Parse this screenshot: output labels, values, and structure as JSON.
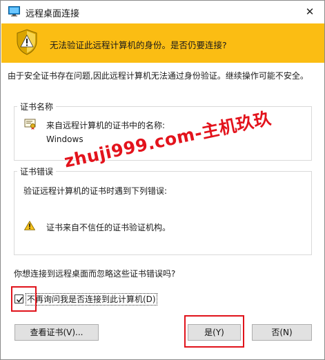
{
  "window": {
    "title": "远程桌面连接",
    "close_glyph": "✕"
  },
  "banner": {
    "text": "无法验证此远程计算机的身份。是否仍要连接?",
    "background": "#fbbd13",
    "icon": "security-shield-warning-icon"
  },
  "intro": {
    "text": "由于安全证书存在问题,因此远程计算机无法通过身份验证。继续操作可能不安全。"
  },
  "cert_name_group": {
    "legend": "证书名称",
    "line1": "来自远程计算机的证书中的名称:",
    "line2": "Windows",
    "icon": "certificate-icon"
  },
  "cert_error_group": {
    "legend": "证书错误",
    "line1": "验证远程计算机的证书时遇到下列错误:",
    "line2": "证书来自不信任的证书验证机构。",
    "icon": "warning-triangle-icon"
  },
  "question": {
    "text": "你想连接到远程桌面而忽略这些证书错误吗?"
  },
  "checkbox": {
    "label": "不再询问我是否连接到此计算机(D)",
    "checked": true
  },
  "buttons": {
    "view_cert": "查看证书(V)...",
    "yes": "是(Y)",
    "no": "否(N)"
  },
  "watermark": {
    "text": "zhuji999.com-主机玖玖",
    "color": "#e3131c"
  },
  "annotation_color": "#e0121a"
}
